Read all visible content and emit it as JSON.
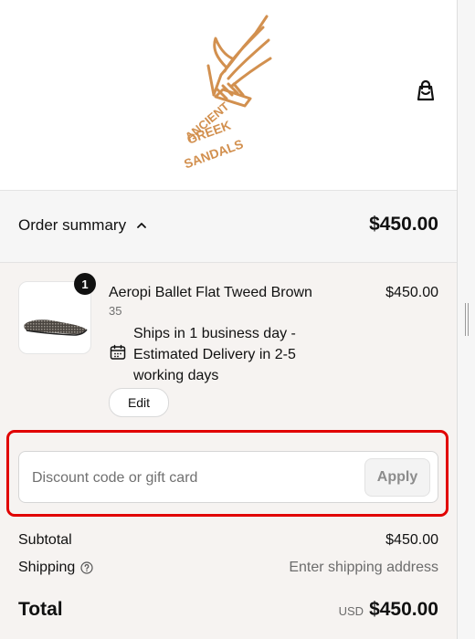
{
  "header": {
    "logo_text": [
      "ANCIENT",
      "GREEK",
      "SANDALS"
    ],
    "logo_color": "#d2904f",
    "cart_icon": "shopping-bag-icon"
  },
  "summary": {
    "label": "Order summary",
    "toggle_icon": "chevron-up-icon",
    "total": "$450.00"
  },
  "item": {
    "quantity": "1",
    "name": "Aeropi Ballet Flat Tweed Brown",
    "variant": "35",
    "price": "$450.00",
    "delivery_icon": "calendar-icon",
    "delivery": "Ships in 1 business day - Estimated Delivery in 2-5 working days",
    "edit_label": "Edit"
  },
  "discount": {
    "placeholder": "Discount code or gift card",
    "apply_label": "Apply",
    "highlight_color": "#e10000"
  },
  "totals": {
    "subtotal_label": "Subtotal",
    "subtotal_value": "$450.00",
    "shipping_label": "Shipping",
    "shipping_help_icon": "question-circle-icon",
    "shipping_value": "Enter shipping address",
    "total_label": "Total",
    "currency": "USD",
    "total_value": "$450.00"
  }
}
